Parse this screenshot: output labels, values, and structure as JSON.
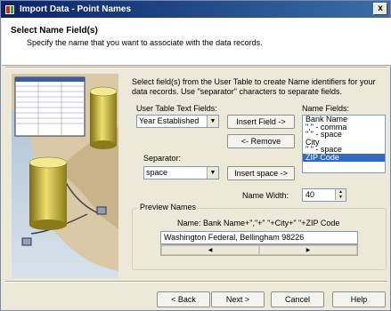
{
  "window": {
    "title": "Import Data - Point Names",
    "close": "x"
  },
  "header": {
    "title": "Select Name Field(s)",
    "subtitle": "Specify the name that you want to associate with the data records."
  },
  "instructions": "Select field(s) from the User Table to create Name identifiers for your data records.  Use \"separator\" characters to separate fields.",
  "user_table": {
    "label": "User Table Text Fields:",
    "value": "Year Established"
  },
  "separator_field": {
    "label": "Separator:",
    "value": "space"
  },
  "buttons": {
    "insert_field": "Insert Field ->",
    "remove": "<- Remove",
    "insert_space": "Insert space ->"
  },
  "name_fields": {
    "label": "Name Fields:",
    "items": [
      "Bank Name",
      "\",\" - comma",
      "\" \" - space",
      "City",
      "\" \" - space",
      "ZIP Code"
    ],
    "selected_index": 5
  },
  "name_width": {
    "label": "Name Width:",
    "value": "40"
  },
  "preview": {
    "group_label": "Preview Names",
    "formula": "Name: Bank Name+\",\"+\" \"+City+\" \"+ZIP Code",
    "value": "Washington Federal, Bellingham 98226"
  },
  "footer": {
    "back": "< Back",
    "next": "Next >",
    "cancel": "Cancel",
    "help": "Help"
  },
  "icons": {
    "combo_arrow": "▼",
    "scroll_left": "◀",
    "scroll_right": "▶",
    "spin_up": "▲",
    "spin_down": "▼"
  }
}
